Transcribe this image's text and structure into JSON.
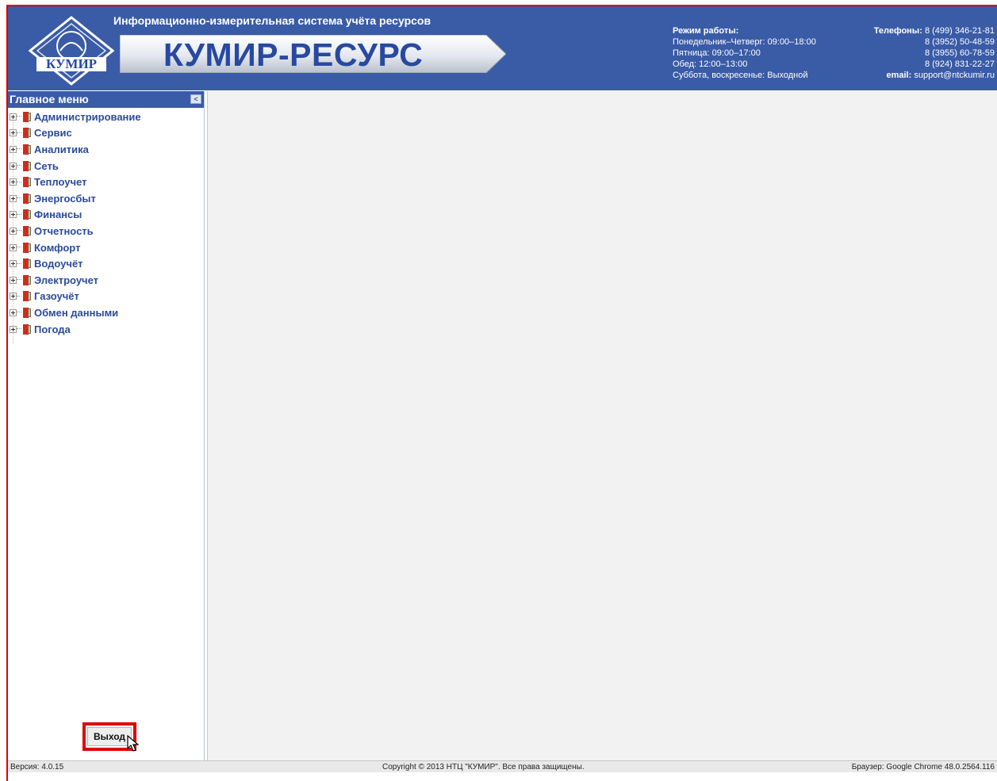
{
  "header": {
    "subtitle": "Информационно-измерительная система учёта ресурсов",
    "product_name": "КУМИР-РЕСУРС",
    "logo_text": "КУМИР",
    "hours": {
      "title": "Режим работы:",
      "line1": "Понедельник–Четверг: 09:00–18:00",
      "line2": "Пятница: 09:00–17:00",
      "line3": "Обед: 12:00–13:00",
      "line4": "Суббота, воскресенье: Выходной"
    },
    "contacts": {
      "phones_label": "Телефоны:",
      "phone1": "8 (499) 346-21-81",
      "phone2": "8 (3952) 50-48-59",
      "phone3": "8 (3955) 60-78-59",
      "phone4": "8 (924) 831-22-27",
      "email_label": "email:",
      "email": "support@ntckumir.ru"
    }
  },
  "sidebar": {
    "title": "Главное меню",
    "collapse_glyph": "<",
    "items": [
      {
        "label": "Администрирование"
      },
      {
        "label": "Сервис"
      },
      {
        "label": "Аналитика"
      },
      {
        "label": "Сеть"
      },
      {
        "label": "Теплоучет"
      },
      {
        "label": "Энергосбыт"
      },
      {
        "label": "Финансы"
      },
      {
        "label": "Отчетность"
      },
      {
        "label": "Комфорт"
      },
      {
        "label": "Водоучёт"
      },
      {
        "label": "Электроучет"
      },
      {
        "label": "Газоучёт"
      },
      {
        "label": "Обмен данными"
      },
      {
        "label": "Погода"
      }
    ],
    "logout_label": "Выход"
  },
  "statusbar": {
    "version": "Версия: 4.0.15",
    "copyright": "Copyright © 2013 НТЦ \"КУМИР\". Все права защищены.",
    "browser": "Браузер: Google Chrome 48.0.2564.116"
  },
  "colors": {
    "header_bg": "#3a5ba6",
    "menu_text": "#2a4a9c",
    "highlight_border": "#e10000"
  }
}
